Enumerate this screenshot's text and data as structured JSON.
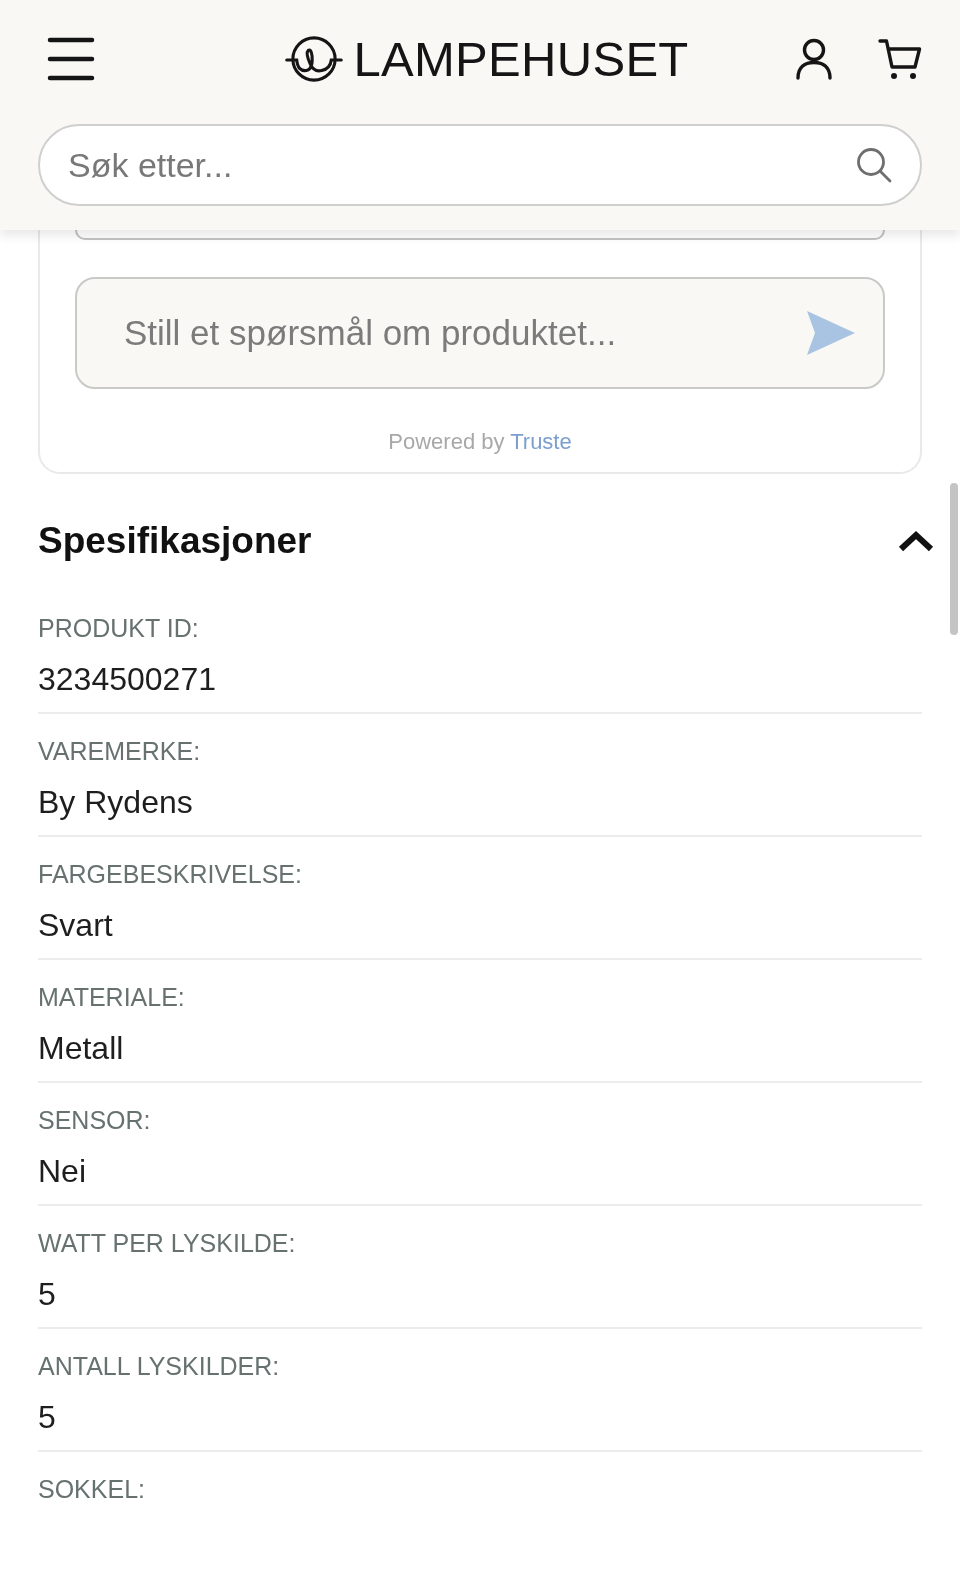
{
  "header": {
    "logo": {
      "text": "LAMPEHUSET"
    },
    "search": {
      "placeholder": "Søk etter..."
    }
  },
  "question_form": {
    "placeholder": "Still et spørsmål om produktet...",
    "powered_by": {
      "text": "Powered by",
      "link": "Truste"
    }
  },
  "specifications": {
    "title": "Spesifikasjoner",
    "expanded": true,
    "items": [
      {
        "label": "PRODUKT ID:",
        "value": "3234500271"
      },
      {
        "label": "VAREMERKE:",
        "value": "By Rydens"
      },
      {
        "label": "FARGEBESKRIVELSE:",
        "value": "Svart"
      },
      {
        "label": "MATERIALE:",
        "value": "Metall"
      },
      {
        "label": "SENSOR:",
        "value": "Nei"
      },
      {
        "label": "WATT PER LYSKILDE:",
        "value": "5"
      },
      {
        "label": "ANTALL LYSKILDER:",
        "value": "5"
      },
      {
        "label": "SOKKEL:"
      }
    ]
  }
}
